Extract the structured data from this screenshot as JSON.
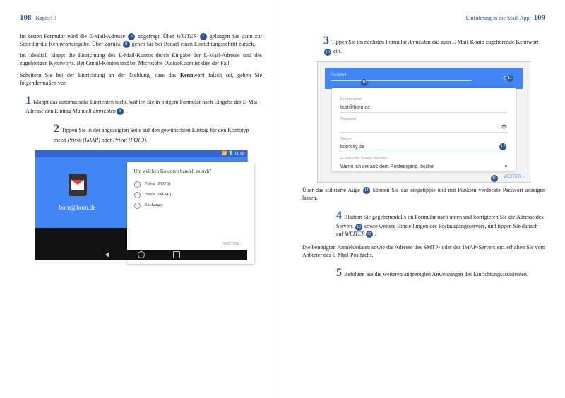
{
  "left": {
    "pagenum": "108",
    "chapter": "Kapitel 3",
    "p1a": "Im ersten Formular wird die E-Mail-Adresse ",
    "p1b": " abgefragt. Über ",
    "p1c": "WEITER",
    "p1d": " gelangen Sie dann zur Seite für die Kennworteingabe. Über ",
    "p1e": "Zurück",
    "p1f": " gehen Sie bei Bedarf einen Einrichtungsschritt zurück.",
    "p2a": "Im Idealfall klappt die Einrichtung des E-Mail-Kontos durch Eingabe der E-Mail-Adresse und des zugehörigen Kennworts. Bei Gmail-Konten und bei Microsofts ",
    "p2b": "Outlook.com",
    "p2c": " ist dies der Fall.",
    "p3a": "Scheitern Sie bei der Einrichtung an der Meldung, dass das ",
    "p3b": "Kennwort",
    "p3c": " falsch sei, gehen Sie folgendermaßen vor.",
    "s1a": "Klappt das automatische Einrichten nicht, wählen Sie in obigem Formular nach Eingabe der E-Mail-Adresse den Eintrag ",
    "s1b": "Manuell einrichten",
    "s1c": " .",
    "s2a": "Tippen Sie in der angezeigten Seite auf den gewünschten Eintrag für den Kontotyp – meist ",
    "s2b": "Privat (IMAP)",
    "s2c": " oder ",
    "s2d": "Privat (POP3)",
    "s2e": ".",
    "shot": {
      "time": "11:50",
      "email": "born@born.de",
      "question": "Um welchen Kontotyp handelt es sich?",
      "opt1": "Privat (POP3)",
      "opt2": "Privat (IMAP)",
      "opt3": "Exchange",
      "weiter": "WEITER ›"
    },
    "badges": {
      "b6": "6",
      "b7": "7",
      "b8": "8",
      "b9": "9"
    }
  },
  "right": {
    "pagenum": "109",
    "chapter": "Einführung in die Mail-App",
    "s3a": "Tippen Sie im nächsten Formular ",
    "s3b": "Anmelden",
    "s3c": " das zum E-Mail-Konto zugehörende Kennwort ",
    "s3d": " ein.",
    "shot": {
      "passLabel": "Passwort",
      "userLabel": "Nutzername",
      "userVal": "test@born.de",
      "passLabel2": "Passwort",
      "serverLabel": "Server",
      "serverVal": "borncity.de",
      "delLabel": "E-Mail vom Server löschen",
      "delVal": "Wenn ich sie aus dem Posteingang lösche",
      "weiter": "WEITER ›"
    },
    "p4a": "Über das stilisierte Auge ",
    "p4b": " können Sie das eingetippte und mit Punkten verdeckte Passwort anzeigen lassen.",
    "s4a": "Blättern Sie gegebenenfalls im Formular nach unten und korrigieren Sie die Adresse des Servers ",
    "s4b": " sowie weitere Einstellungen des Postausgangsservers, und tippen Sie danach auf ",
    "s4c": "WEITER",
    "s4d": " .",
    "p5": "Die benötigten Anmeldedaten sowie die Adresse des SMTP- oder des IMAP-Servers etc. erhalten Sie vom Anbieter des E-Mail-Postfachs.",
    "s5": "Befolgen Sie die weiteren angezeigten Anweisungen des Einrichtungsassistenten.",
    "badges": {
      "b10": "10",
      "b11": "11",
      "b12": "12",
      "b13": "13"
    },
    "nums": {
      "n3": "3",
      "n4": "4",
      "n5": "5"
    }
  },
  "leftnums": {
    "n1": "1",
    "n2": "2"
  }
}
